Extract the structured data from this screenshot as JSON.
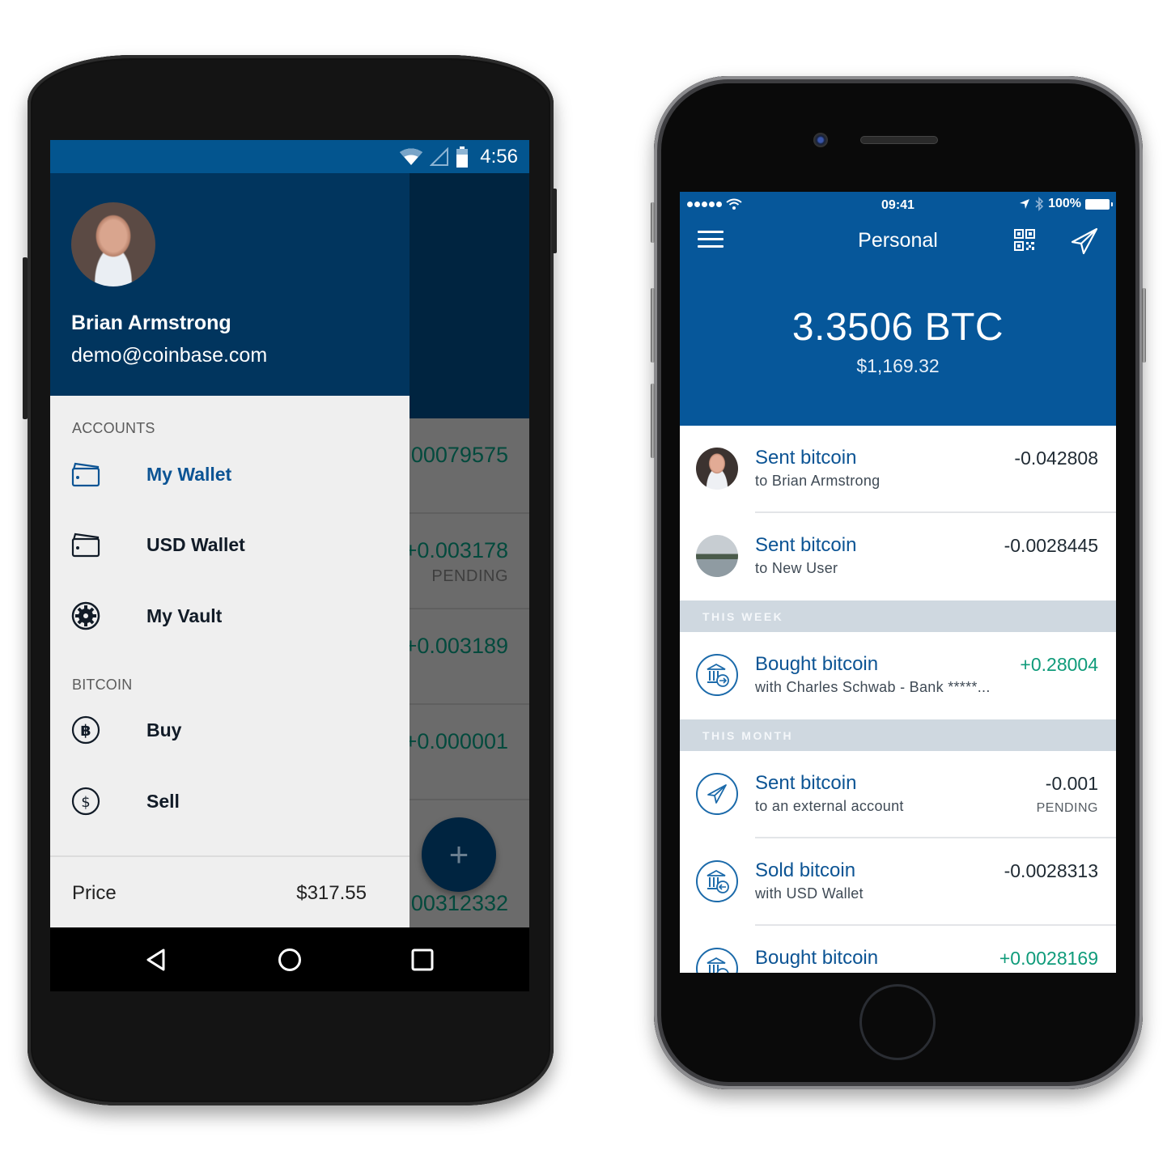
{
  "android": {
    "status_bar": {
      "time": "4:56",
      "icons": [
        "wifi-icon",
        "signal-icon",
        "battery-icon"
      ]
    },
    "drawer": {
      "user_name": "Brian Armstrong",
      "user_email": "demo@coinbase.com",
      "sections": [
        {
          "title": "ACCOUNTS",
          "items": [
            {
              "label": "My Wallet",
              "icon": "wallet-icon",
              "active": true
            },
            {
              "label": "USD Wallet",
              "icon": "wallet-icon",
              "active": false
            },
            {
              "label": "My Vault",
              "icon": "vault-icon",
              "active": false
            }
          ]
        },
        {
          "title": "BITCOIN",
          "items": [
            {
              "label": "Buy",
              "icon": "bitcoin-icon",
              "active": false
            },
            {
              "label": "Sell",
              "icon": "dollar-icon",
              "active": false
            }
          ]
        }
      ],
      "price_label": "Price",
      "price_value": "$317.55"
    },
    "background_list": [
      {
        "amount": "00079575",
        "status": ""
      },
      {
        "amount": "+0.003178",
        "status": "PENDING"
      },
      {
        "amount": "+0.003189",
        "status": ""
      },
      {
        "amount": "+0.000001",
        "status": ""
      },
      {
        "amount": "00312332",
        "status": ""
      }
    ],
    "fab_label": "+",
    "nav_buttons": [
      "back-icon",
      "home-icon",
      "recents-icon"
    ]
  },
  "iphone": {
    "status_bar": {
      "time": "09:41",
      "battery": "100%"
    },
    "nav": {
      "title": "Personal"
    },
    "balance": {
      "btc": "3.3506 BTC",
      "fiat": "$1,169.32"
    },
    "transactions": [
      {
        "type": "row",
        "title": "Sent bitcoin",
        "subtitle": "to Brian Armstrong",
        "amount": "-0.042808",
        "positive": false,
        "status": "",
        "avatar": "person"
      },
      {
        "type": "row",
        "title": "Sent bitcoin",
        "subtitle": "to New User",
        "amount": "-0.0028445",
        "positive": false,
        "status": "",
        "avatar": "lake"
      },
      {
        "type": "section",
        "label": "THIS WEEK"
      },
      {
        "type": "row",
        "title": "Bought bitcoin",
        "subtitle": "with Charles Schwab - Bank *****...",
        "amount": "+0.28004",
        "positive": true,
        "status": "",
        "avatar": "bank-in"
      },
      {
        "type": "section",
        "label": "THIS MONTH"
      },
      {
        "type": "row",
        "title": "Sent bitcoin",
        "subtitle": "to an external account",
        "amount": "-0.001",
        "positive": false,
        "status": "PENDING",
        "avatar": "send"
      },
      {
        "type": "row",
        "title": "Sold bitcoin",
        "subtitle": "with USD Wallet",
        "amount": "-0.0028313",
        "positive": false,
        "status": "",
        "avatar": "bank-out"
      },
      {
        "type": "row",
        "title": "Bought bitcoin",
        "subtitle": "",
        "amount": "+0.0028169",
        "positive": true,
        "status": "",
        "avatar": "bank-in"
      }
    ]
  },
  "colors": {
    "android_status": "#03558f",
    "drawer_header": "#01355e",
    "active_item": "#0c5494",
    "ios_header": "#06579a",
    "positive_amount": "#0f9b7a",
    "section_bg": "#cfd8e0"
  }
}
